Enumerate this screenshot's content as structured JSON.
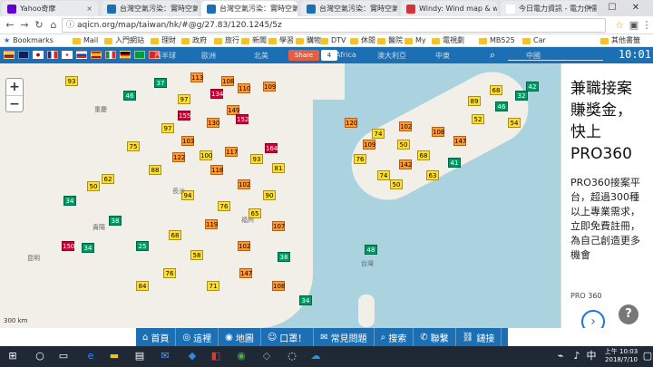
{
  "browser": {
    "tabs": [
      {
        "label": "Yahoo奇摩",
        "active": false,
        "favicon_color": "#6001d2"
      },
      {
        "label": "台灣空氣污染：實時空氣",
        "active": false,
        "favicon_color": "#1c6fb3"
      },
      {
        "label": "台灣空氣污染：實時空氣",
        "active": true,
        "favicon_color": "#1c6fb3"
      },
      {
        "label": "台灣空氣污染：實時空氣",
        "active": false,
        "favicon_color": "#1c6fb3"
      },
      {
        "label": "Windy: Wind map & wea",
        "active": false,
        "favicon_color": "#d13438"
      },
      {
        "label": "今日電力資訊 - 電力供需",
        "active": false,
        "favicon_color": "#ffffff"
      }
    ],
    "url": "aqicn.org/map/taiwan/hk/#@g/27.83/120.1245/5z",
    "bookmarks_label": "Bookmarks",
    "bookmarks": [
      "Mail",
      "入門網站",
      "理財",
      "政府",
      "旅行",
      "新聞",
      "學習",
      "購物",
      "DTV",
      "休閒",
      "醫院",
      "My",
      "電視劇",
      "MB525",
      "Car"
    ],
    "other_bookmarks": "其他書籤"
  },
  "site": {
    "share_label": "Share",
    "share_count": "4",
    "clock": "10:01",
    "region_tabs": [
      "西半球",
      "歐洲",
      "北美",
      "Africa",
      "澳大利亞",
      "中東",
      "中國"
    ]
  },
  "map": {
    "zoom_in": "+",
    "zoom_out": "−",
    "labels": [
      "台灣",
      "重慶",
      "貴陽",
      "昆明",
      "長沙",
      "福州"
    ],
    "scale": "300 km",
    "markers": [
      {
        "v": "93",
        "c": "y"
      },
      {
        "v": "113",
        "c": "o"
      },
      {
        "v": "108",
        "c": "o"
      },
      {
        "v": "134",
        "c": "r"
      },
      {
        "v": "110",
        "c": "o"
      },
      {
        "v": "109",
        "c": "o"
      },
      {
        "v": "97",
        "c": "y"
      },
      {
        "v": "149",
        "c": "o"
      },
      {
        "v": "155",
        "c": "r"
      },
      {
        "v": "97",
        "c": "y"
      },
      {
        "v": "130",
        "c": "o"
      },
      {
        "v": "152",
        "c": "r"
      },
      {
        "v": "103",
        "c": "o"
      },
      {
        "v": "75",
        "c": "y"
      },
      {
        "v": "122",
        "c": "o"
      },
      {
        "v": "100",
        "c": "y"
      },
      {
        "v": "117",
        "c": "o"
      },
      {
        "v": "93",
        "c": "y"
      },
      {
        "v": "81",
        "c": "y"
      },
      {
        "v": "88",
        "c": "y"
      },
      {
        "v": "62",
        "c": "y"
      },
      {
        "v": "50",
        "c": "y"
      },
      {
        "v": "34",
        "c": "g"
      },
      {
        "v": "37",
        "c": "g"
      },
      {
        "v": "46",
        "c": "g"
      },
      {
        "v": "164",
        "c": "r"
      },
      {
        "v": "118",
        "c": "o"
      },
      {
        "v": "102",
        "c": "o"
      },
      {
        "v": "90",
        "c": "y"
      },
      {
        "v": "94",
        "c": "y"
      },
      {
        "v": "76",
        "c": "y"
      },
      {
        "v": "65",
        "c": "y"
      },
      {
        "v": "119",
        "c": "o"
      },
      {
        "v": "107",
        "c": "o"
      },
      {
        "v": "68",
        "c": "y"
      },
      {
        "v": "38",
        "c": "g"
      },
      {
        "v": "25",
        "c": "g"
      },
      {
        "v": "34",
        "c": "g"
      },
      {
        "v": "150",
        "c": "r"
      },
      {
        "v": "102",
        "c": "o"
      },
      {
        "v": "58",
        "c": "y"
      },
      {
        "v": "76",
        "c": "y"
      },
      {
        "v": "84",
        "c": "y"
      },
      {
        "v": "71",
        "c": "y"
      },
      {
        "v": "147",
        "c": "o"
      },
      {
        "v": "108",
        "c": "o"
      },
      {
        "v": "120",
        "c": "o"
      },
      {
        "v": "74",
        "c": "y"
      },
      {
        "v": "50",
        "c": "y"
      },
      {
        "v": "68",
        "c": "y"
      },
      {
        "v": "108",
        "c": "o"
      },
      {
        "v": "147",
        "c": "o"
      },
      {
        "v": "52",
        "c": "y"
      },
      {
        "v": "46",
        "c": "g"
      },
      {
        "v": "32",
        "c": "g"
      },
      {
        "v": "42",
        "c": "g"
      },
      {
        "v": "142",
        "c": "o"
      },
      {
        "v": "74",
        "c": "y"
      },
      {
        "v": "63",
        "c": "y"
      },
      {
        "v": "41",
        "c": "g"
      },
      {
        "v": "50",
        "c": "y"
      },
      {
        "v": "76",
        "c": "y"
      },
      {
        "v": "109",
        "c": "o"
      },
      {
        "v": "89",
        "c": "y"
      },
      {
        "v": "68",
        "c": "y"
      },
      {
        "v": "102",
        "c": "o"
      },
      {
        "v": "54",
        "c": "y"
      },
      {
        "v": "48",
        "c": "g"
      },
      {
        "v": "34",
        "c": "g"
      },
      {
        "v": "38",
        "c": "g"
      }
    ]
  },
  "ad": {
    "headline": "兼職接案賺獎金，快上PRO360",
    "body": "PRO360接案平台，超過300種以上專業需求，立即免費註冊，為自己創造更多機會",
    "brand": "PRO 360"
  },
  "nav": {
    "items": [
      {
        "icon": "⌂",
        "label": "首頁"
      },
      {
        "icon": "◎",
        "label": "這裡"
      },
      {
        "icon": "◉",
        "label": "地圖"
      },
      {
        "icon": "☺",
        "label": "口罩！"
      },
      {
        "icon": "✉",
        "label": "常見問題"
      },
      {
        "icon": "⌕",
        "label": "搜索"
      },
      {
        "icon": "✆",
        "label": "聯繫"
      },
      {
        "icon": "⛓",
        "label": "鏈接"
      },
      {
        "icon": "⚙",
        "label": ""
      }
    ]
  },
  "taskbar": {
    "time": "上午 10:03",
    "date": "2018/7/10"
  }
}
